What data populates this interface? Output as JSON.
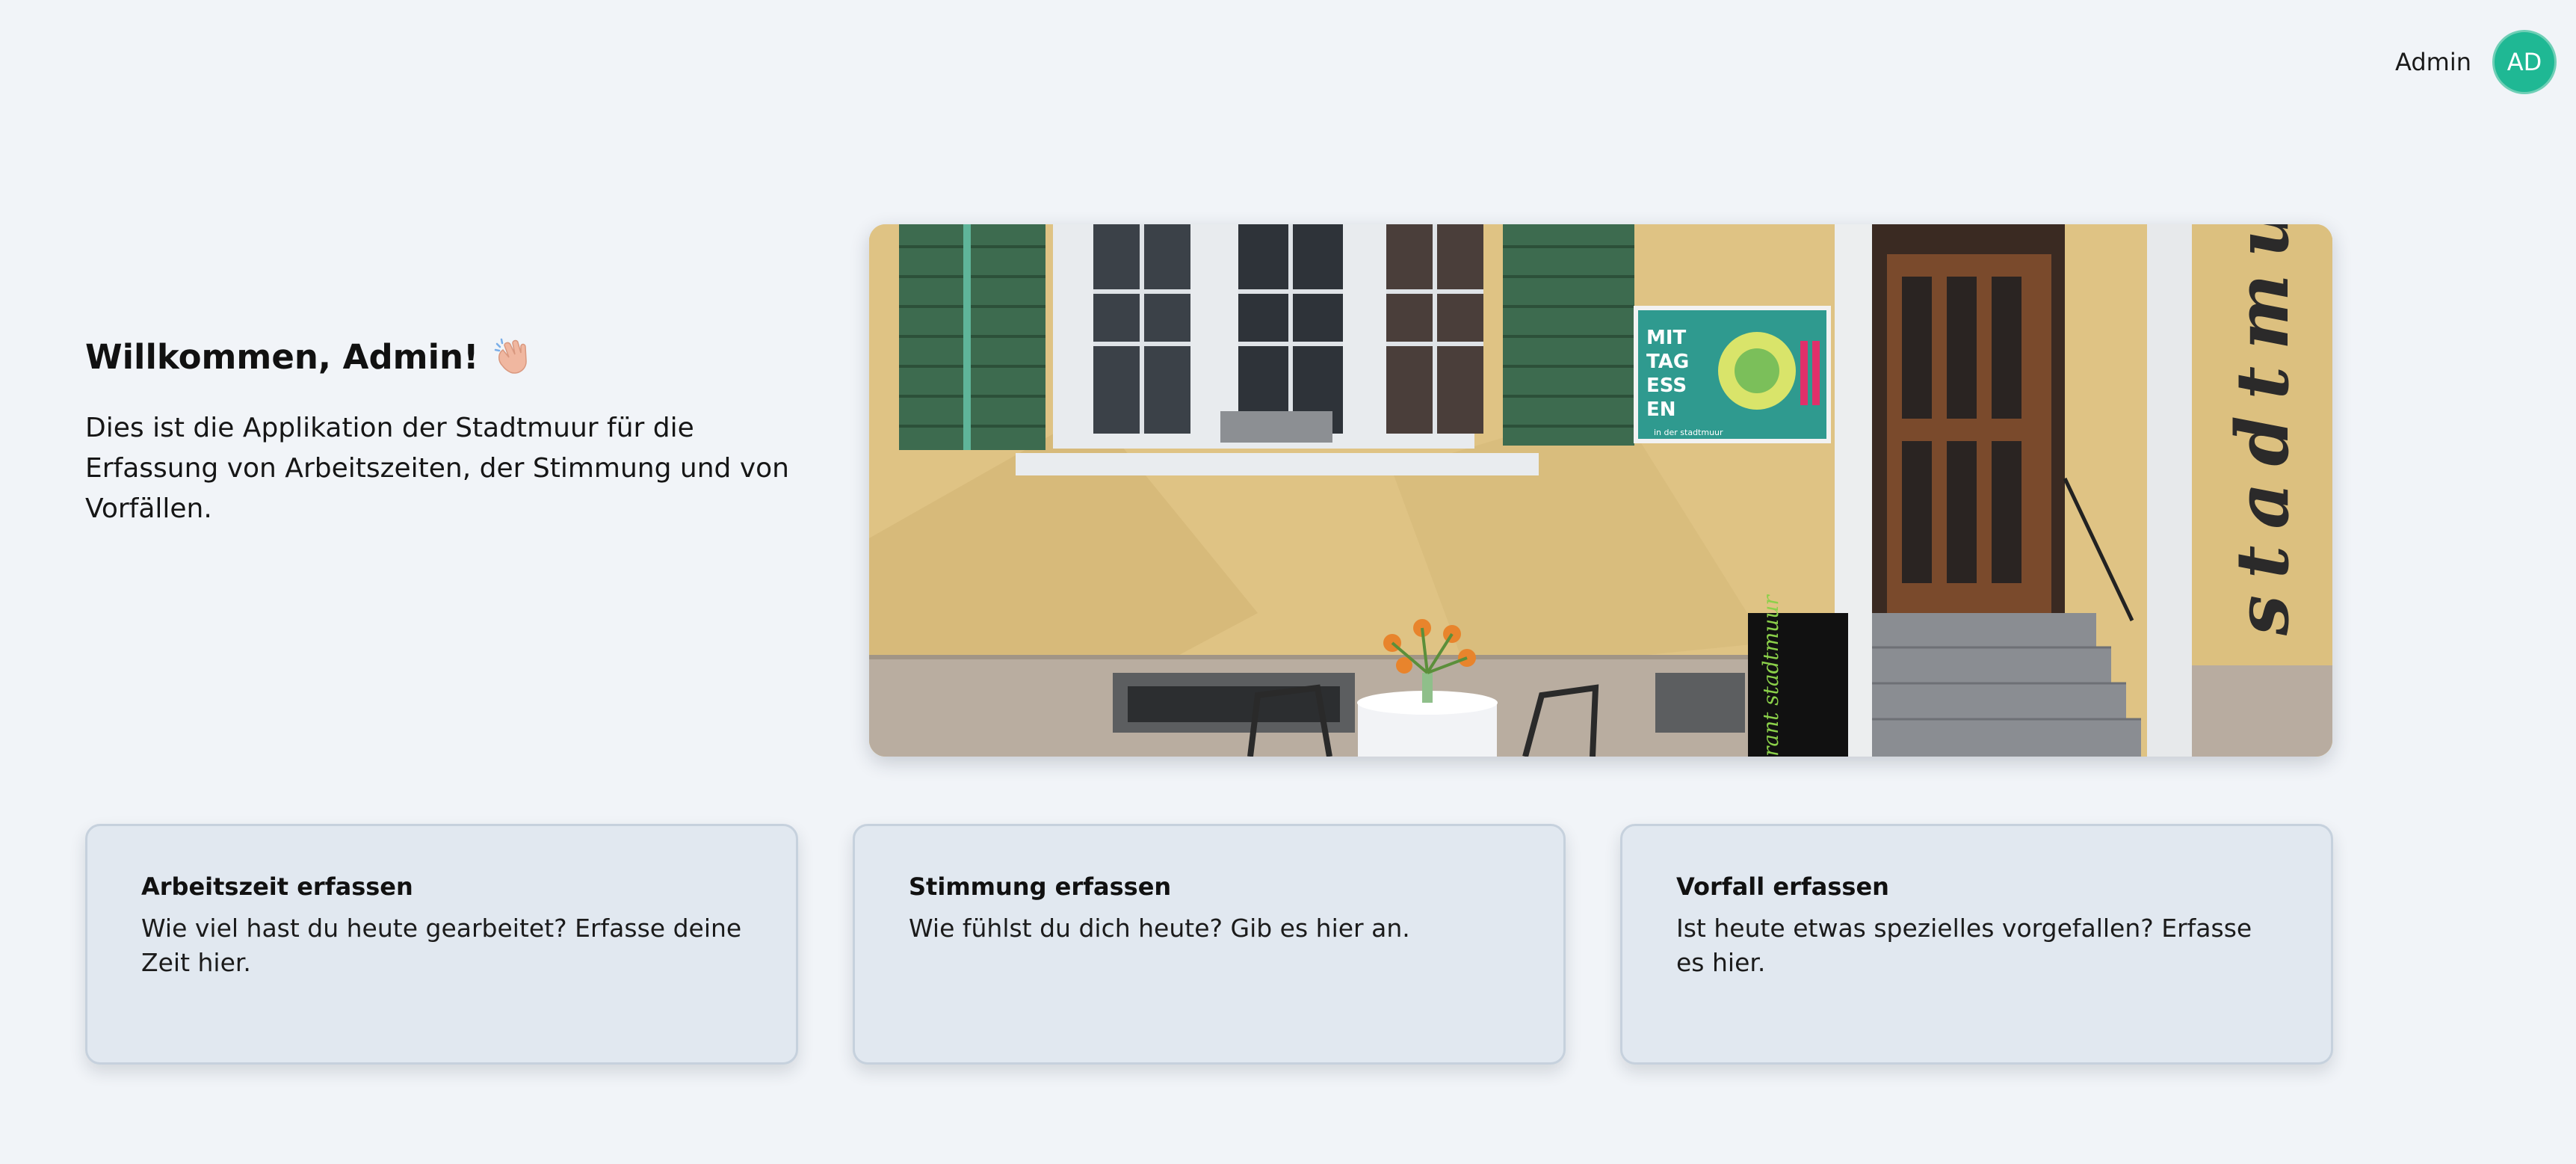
{
  "header": {
    "user_name": "Admin",
    "avatar_initials": "AD",
    "avatar_color": "#1fb894"
  },
  "welcome": {
    "title": "Willkommen, Admin!",
    "wave_icon": "waving-hand-icon",
    "text": "Dies ist die Applikation der Stadtmuur für die Erfassung von Arbeitszeiten, der Stimmung und von Vorfällen."
  },
  "hero": {
    "facade_text": "stadtmuur",
    "sign_text": "rant stadtmuur",
    "banner_lines": [
      "MIT",
      "TAG",
      "ESS",
      "EN"
    ],
    "banner_subtext": "in der stadtmuur"
  },
  "cards": [
    {
      "title": "Arbeitszeit erfassen",
      "text": "Wie viel hast du heute gearbeitet? Erfasse deine Zeit hier."
    },
    {
      "title": "Stimmung erfassen",
      "text": "Wie fühlst du dich heute? Gib es hier an."
    },
    {
      "title": "Vorfall erfassen",
      "text": "Ist heute etwas spezielles vorgefallen? Erfasse es hier."
    }
  ]
}
